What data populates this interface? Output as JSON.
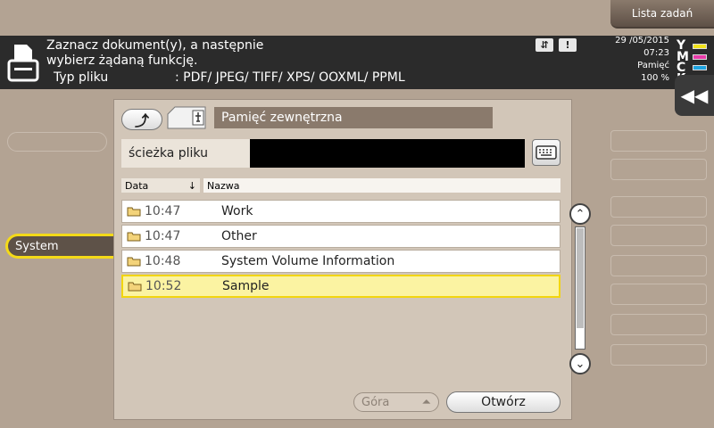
{
  "top_tab": {
    "label": "Lista zadań"
  },
  "header": {
    "line1": "Zaznacz dokument(y), a następnie",
    "line2": "wybierz żądaną funkcję.",
    "file_type_label": "Typ pliku",
    "file_type_value": ": PDF/ JPEG/ TIFF/ XPS/ OOXML/ PPML",
    "date": "29 /05/2015",
    "time": "07:23",
    "memory_label": "Pamięć",
    "memory_value": "100 %",
    "toner": [
      {
        "letter": "Y",
        "color": "#f1e21b"
      },
      {
        "letter": "M",
        "color": "#e83aa8"
      },
      {
        "letter": "C",
        "color": "#1ea3e0"
      },
      {
        "letter": "K",
        "color": "#222222"
      }
    ]
  },
  "sidebar": {
    "selected_label": "System"
  },
  "panel": {
    "location": "Pamięć zewnętrzna",
    "path_label": "ścieżka pliku",
    "path_value": "",
    "columns": {
      "date": "Data",
      "name": "Nazwa"
    },
    "files": [
      {
        "time": "10:47",
        "name": "Work",
        "selected": false
      },
      {
        "time": "10:47",
        "name": "Other",
        "selected": false
      },
      {
        "time": "10:48",
        "name": "System Volume Information",
        "selected": false
      },
      {
        "time": "10:52",
        "name": "Sample",
        "selected": true
      }
    ],
    "top_button": "Góra",
    "open_button": "Otwórz"
  },
  "icons": {
    "up": "folder-up-icon",
    "keyboard": "keyboard-icon",
    "usb": "usb-icon",
    "collapse": "double-chevron-left-icon"
  }
}
